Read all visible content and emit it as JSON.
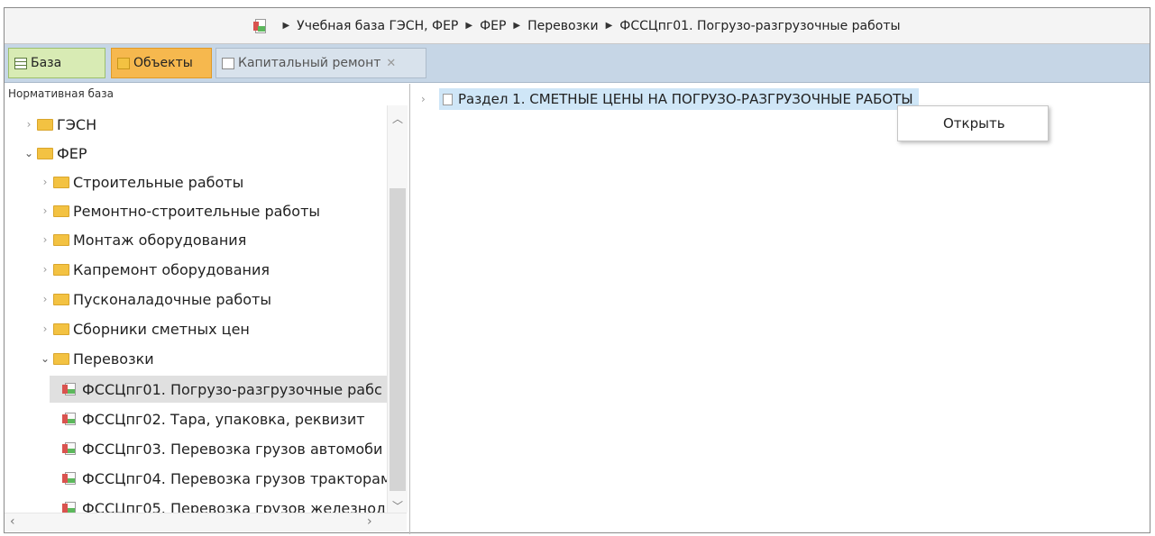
{
  "breadcrumb": {
    "items": [
      "Учебная база ГЭСН, ФЕР",
      "ФЕР",
      "Перевозки",
      "ФССЦпг01. Погрузо-разгрузочные работы"
    ]
  },
  "tabs": [
    {
      "label": "База",
      "icon": "table-icon"
    },
    {
      "label": "Объекты",
      "icon": "folder-icon"
    },
    {
      "label": "Капитальный ремонт",
      "icon": "document-icon",
      "closable": true
    }
  ],
  "tab_close_glyph": "✕",
  "left_panel": {
    "title": "Нормативная база",
    "tree": [
      {
        "label": "ГЭСН",
        "level": 0,
        "type": "folder",
        "expanded": false
      },
      {
        "label": "ФЕР",
        "level": 0,
        "type": "folder",
        "expanded": true
      },
      {
        "label": "Строительные работы",
        "level": 1,
        "type": "folder",
        "expanded": false
      },
      {
        "label": "Ремонтно-строительные работы",
        "level": 1,
        "type": "folder",
        "expanded": false
      },
      {
        "label": "Монтаж оборудования",
        "level": 1,
        "type": "folder",
        "expanded": false
      },
      {
        "label": "Капремонт оборудования",
        "level": 1,
        "type": "folder",
        "expanded": false
      },
      {
        "label": "Пусконаладочные работы",
        "level": 1,
        "type": "folder",
        "expanded": false
      },
      {
        "label": "Сборники сметных цен",
        "level": 1,
        "type": "folder",
        "expanded": false
      },
      {
        "label": "Перевозки",
        "level": 1,
        "type": "folder",
        "expanded": true
      },
      {
        "label": "ФССЦпг01. Погрузо-разгрузочные рабс",
        "level": 2,
        "type": "book",
        "selected": true
      },
      {
        "label": "ФССЦпг02. Тара, упаковка, реквизит",
        "level": 2,
        "type": "book"
      },
      {
        "label": "ФССЦпг03. Перевозка грузов автомоби",
        "level": 2,
        "type": "book"
      },
      {
        "label": "ФССЦпг04. Перевозка грузов тракторам",
        "level": 2,
        "type": "book"
      },
      {
        "label": "ФССЦпг05. Перевозка грузов железнод",
        "level": 2,
        "type": "book"
      }
    ]
  },
  "right_panel": {
    "section_label": "Раздел 1. СМЕТНЫЕ ЦЕНЫ НА ПОГРУЗО-РАЗГРУЗОЧНЫЕ РАБОТЫ"
  },
  "context_menu": {
    "items": [
      "Открыть"
    ]
  }
}
